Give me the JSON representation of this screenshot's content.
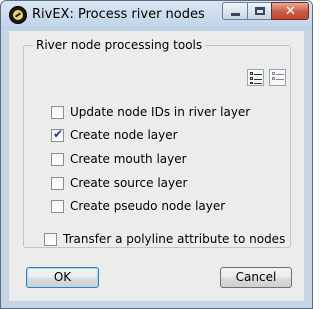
{
  "window": {
    "title": "RivEX: Process river nodes",
    "close_glyph": "✕"
  },
  "group": {
    "legend": "River node processing tools",
    "select_all_icon": "list-select-all-icon",
    "select_none_icon": "list-select-none-icon"
  },
  "options": [
    {
      "label": "Update node IDs in river layer",
      "checked": false
    },
    {
      "label": "Create node layer",
      "checked": true
    },
    {
      "label": "Create mouth layer",
      "checked": false
    },
    {
      "label": "Create source layer",
      "checked": false
    },
    {
      "label": "Create pseudo node layer",
      "checked": false
    },
    {
      "label": "Transfer a polyline attribute to nodes",
      "checked": false
    }
  ],
  "buttons": {
    "ok": "OK",
    "cancel": "Cancel"
  },
  "colors": {
    "titlebar": "#c6d4e4",
    "close_button": "#c95a43",
    "dialog_bg": "#ececec"
  }
}
